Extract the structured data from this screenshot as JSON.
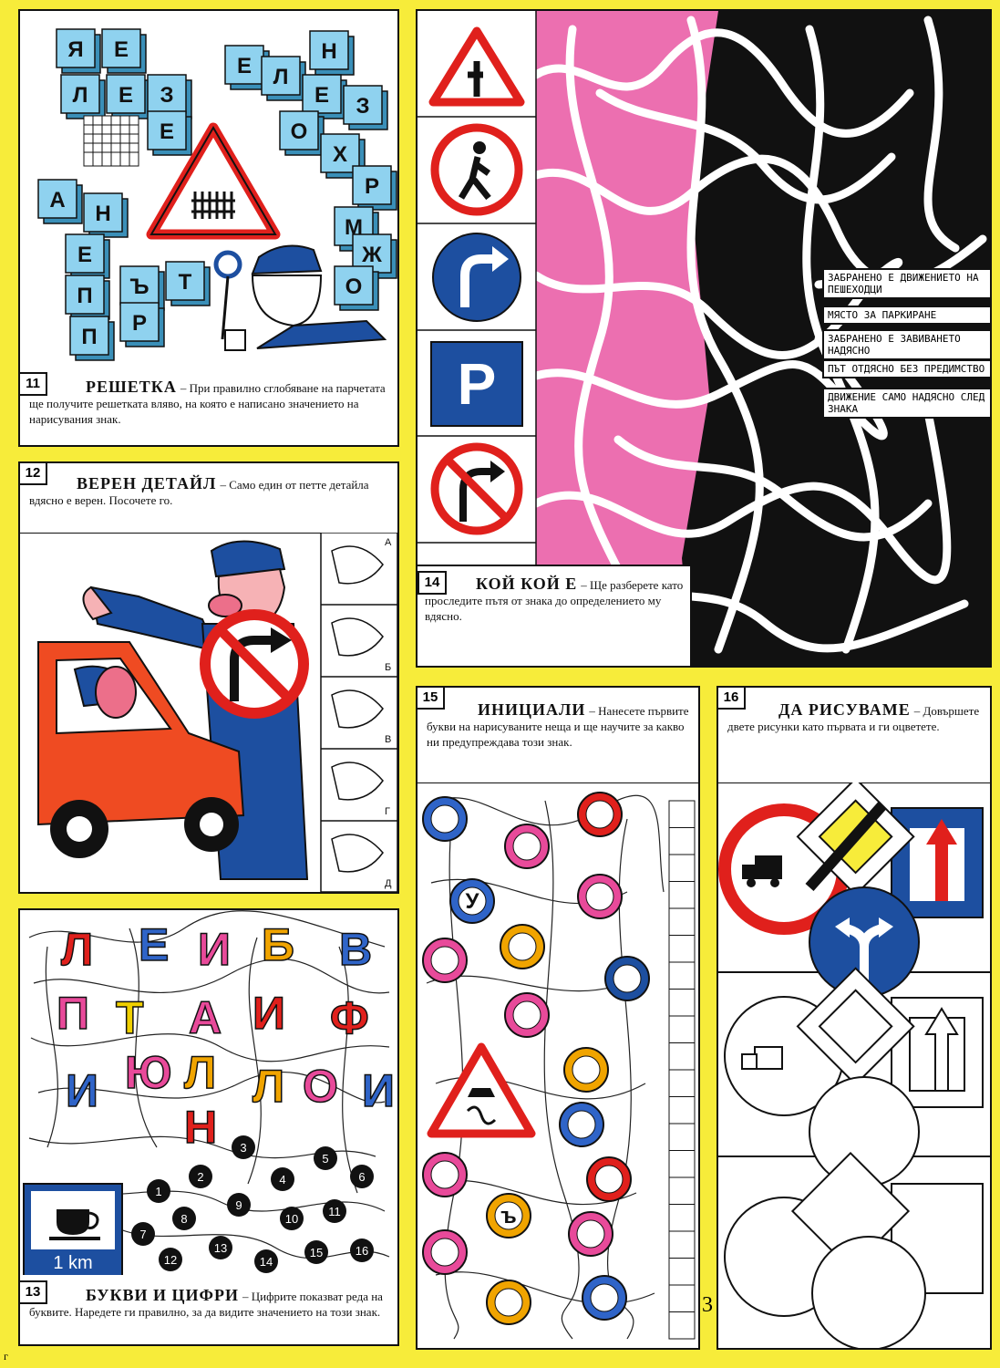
{
  "panels": {
    "p11": {
      "number": "11",
      "title": "РЕШЕТКА",
      "text": "– При правилно сглобяване на парчетата ще получите решетката вляво, на която е написано значението на нарисувания знак.",
      "letters": [
        "Я",
        "Е",
        "Л",
        "Е",
        "З",
        "Е",
        "Н",
        "Е",
        "Л",
        "Е",
        "З",
        "О",
        "Х",
        "Р",
        "М",
        "Ж",
        "О",
        "А",
        "Н",
        "Е",
        "П",
        "П",
        "Ъ",
        "Т",
        "Р"
      ]
    },
    "p12": {
      "number": "12",
      "title": "ВЕРЕН ДЕТАЙЛ",
      "text": "– Само един от петте детайла вдясно е верен. Посочете го.",
      "options": [
        "А",
        "Б",
        "В",
        "Г",
        "Д"
      ]
    },
    "p13": {
      "number": "13",
      "title": "БУКВИ И ЦИФРИ",
      "text": "– Цифрите показват реда на буквите. Наредете ги правилно, за да видите значението на този знак.",
      "letters": [
        "Л",
        "Е",
        "И",
        "Б",
        "В",
        "П",
        "Т",
        "А",
        "И",
        "Ф",
        "Ю",
        "Л",
        "И",
        "Л",
        "О",
        "И",
        "Н"
      ],
      "digits": [
        "1",
        "2",
        "3",
        "4",
        "5",
        "6",
        "7",
        "8",
        "9",
        "10",
        "11",
        "12",
        "13",
        "14",
        "15",
        "16"
      ],
      "sign_label": "1 km"
    },
    "p14": {
      "number": "14",
      "title": "КОЙ КОЙ Е",
      "text": "– Ще разберете като проследите пътя от знака до определението му вдясно.",
      "sign_p": "P",
      "legend": [
        "ЗАБРАНЕНО Е ДВИЖЕНИЕТО НА ПЕШЕХОДЦИ",
        "МЯСТО ЗА ПАРКИРАНЕ",
        "ЗАБРАНЕНО Е ЗАВИВАНЕТО НАДЯСНО",
        "ПЪТ ОТДЯСНО БЕЗ ПРЕДИМСТВО",
        "ДВИЖЕНИЕ САМО НАДЯСНО СЛЕД ЗНАКА"
      ]
    },
    "p15": {
      "number": "15",
      "title": "ИНИЦИАЛИ",
      "text": "– Нанесете първите букви на нарисуваните неща и ще научите за какво ни предупреждава този знак.",
      "circle_letters": [
        "У",
        "ъ"
      ]
    },
    "p16": {
      "number": "16",
      "title": "ДА РИСУВАМЕ",
      "text": "– Довършете двете рисунки като първата и ги оцветете."
    }
  },
  "page_number": "3",
  "edge_mark": "г",
  "colors": {
    "background": "#f7ec3a",
    "red": "#e0201c",
    "blue": "#1d4fa0",
    "cyan": "#7cc9ea",
    "pink": "#ef6aa8"
  }
}
